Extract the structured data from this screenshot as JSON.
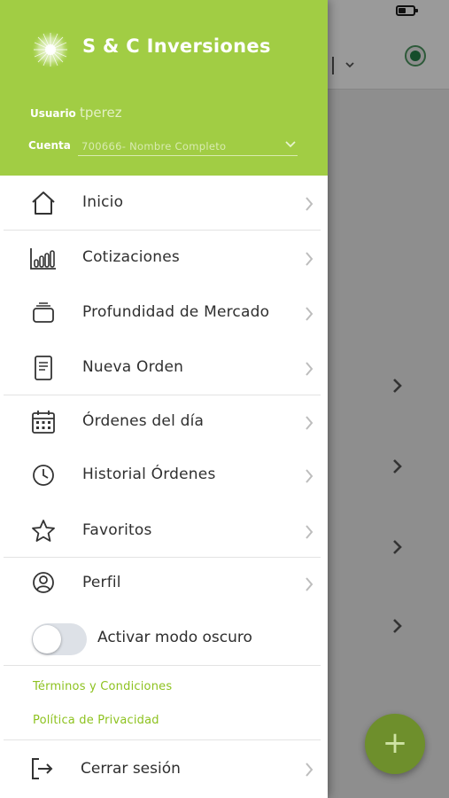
{
  "header": {
    "app_title": "S & C Inversiones",
    "usuario_label": "Usuario",
    "usuario_value": "tperez",
    "cuenta_label": "Cuenta",
    "cuenta_value": "700666- Nombre Completo",
    "accent_color": "#a1cd44"
  },
  "menu": {
    "items": [
      {
        "label": "Inicio",
        "icon": "home-icon"
      },
      {
        "label": "Cotizaciones",
        "icon": "bar-chart-icon"
      },
      {
        "label": "Profundidad de Mercado",
        "icon": "stack-icon"
      },
      {
        "label": "Nueva Orden",
        "icon": "document-icon"
      },
      {
        "label": "Órdenes del día",
        "icon": "calendar-icon"
      },
      {
        "label": "Historial Órdenes",
        "icon": "clock-icon"
      },
      {
        "label": "Favoritos",
        "icon": "star-icon"
      },
      {
        "label": "Perfil",
        "icon": "user-circle-icon"
      }
    ],
    "dark_mode_label": "Activar modo oscuro",
    "dark_mode_on": false,
    "terms_label": "Términos y Condiciones",
    "privacy_label": "Política de Privacidad",
    "logout_label": "Cerrar sesión"
  },
  "background": {
    "fab_label": "+"
  }
}
